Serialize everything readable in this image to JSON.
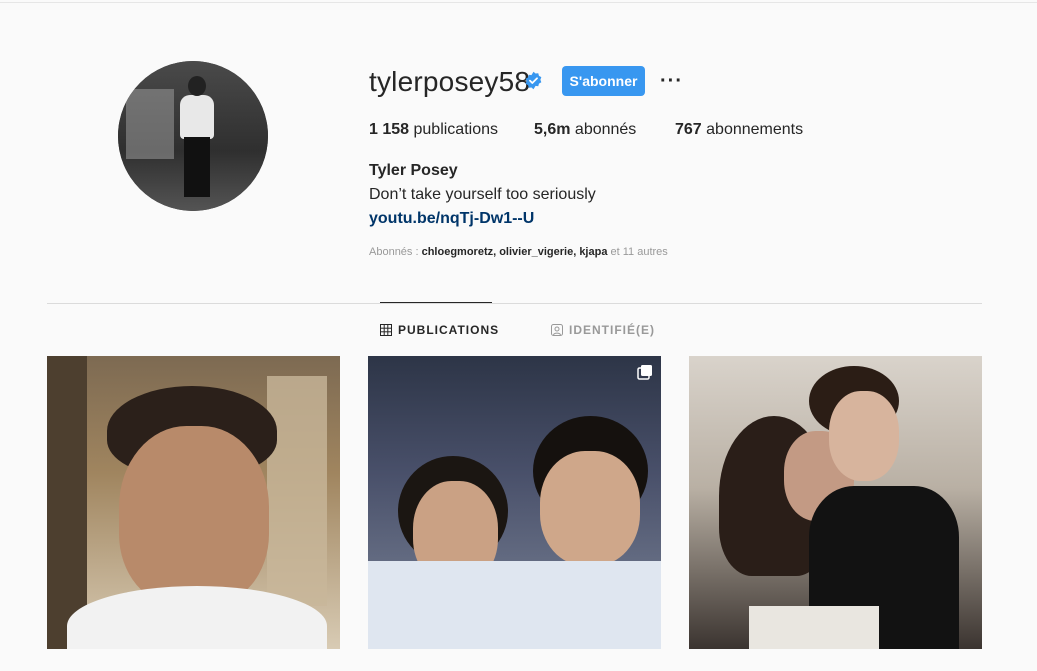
{
  "profile": {
    "username": "tylerposey58",
    "follow_label": "S'abonner",
    "more_label": "···",
    "stats": {
      "posts_value": "1 158",
      "posts_label": " publications",
      "followers_value": "5,6m",
      "followers_label": " abonnés",
      "following_value": "767",
      "following_label": " abonnements"
    },
    "full_name": "Tyler Posey",
    "bio": "Don’t take yourself too seriously",
    "link": "youtu.be/nqTj-Dw1--U",
    "followed_by": {
      "prefix": "Abonnés : ",
      "names": "chloegmoretz, olivier_vigerie, kjapa",
      "suffix": " et 11 autres"
    }
  },
  "tabs": [
    {
      "label": "PUBLICATIONS",
      "icon": "grid-icon",
      "active": true
    },
    {
      "label": "IDENTIFIÉ(E)",
      "icon": "tagged-icon",
      "active": false
    }
  ],
  "colors": {
    "accent": "#3897f0",
    "link": "#003569",
    "muted": "#999999",
    "text": "#262626"
  }
}
